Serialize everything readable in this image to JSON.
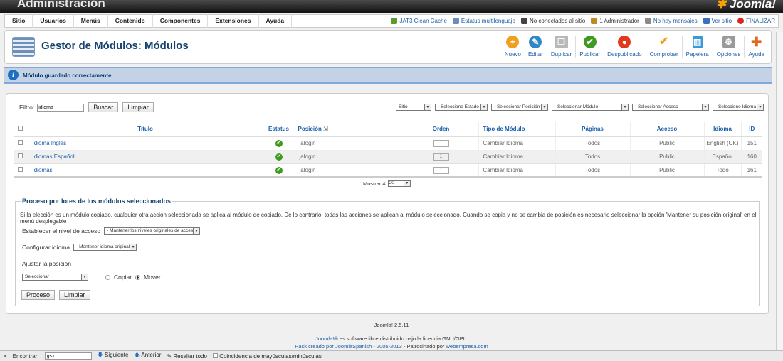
{
  "app": {
    "title": "Administración",
    "logo": "Joomla!"
  },
  "menu": [
    "Sitio",
    "Usuarios",
    "Menús",
    "Contenido",
    "Componentes",
    "Extensiones",
    "Ayuda"
  ],
  "status": {
    "items": [
      {
        "label": "JAT3 Clean Cache",
        "link": true,
        "icon_color": "#5a9b2f"
      },
      {
        "label": "Estatus multilenguaje",
        "link": true,
        "icon_color": "#6a8cc0"
      },
      {
        "label": "No conectados al sitio",
        "link": false,
        "icon_color": "#444444"
      },
      {
        "label": "1 Administrador",
        "link": false,
        "icon_color": "#c08a20"
      },
      {
        "label": "No hay mensajes",
        "link": true,
        "icon_color": "#8a8a8a"
      },
      {
        "label": "Ver sitio",
        "link": true,
        "icon_color": "#3a6ec0"
      }
    ],
    "logout": "FINALIZAR"
  },
  "page": {
    "title": "Gestor de Módulos: Módulos"
  },
  "toolbar": [
    {
      "label": "Nuevo",
      "icon": "plus-icon",
      "color": "#f0a020",
      "glyph": "+"
    },
    {
      "label": "Editar",
      "icon": "pencil-icon",
      "color": "#2e88c8",
      "glyph": "✎"
    },
    {
      "label": "Duplicar",
      "icon": "copy-icon",
      "color": "#b8b8b8",
      "glyph": "❐"
    },
    {
      "label": "Publicar",
      "icon": "check-icon",
      "color": "#3e9a20",
      "glyph": "✔"
    },
    {
      "label": "Despublicado",
      "icon": "unpublish-icon",
      "color": "#e0391c",
      "glyph": "●"
    },
    {
      "label": "Comprobar",
      "icon": "checkin-icon",
      "color": "#f0a020",
      "glyph": "✔"
    },
    {
      "label": "Papelera",
      "icon": "trash-icon",
      "color": "#3a9ad8",
      "glyph": "🗑"
    },
    {
      "label": "Opciones",
      "icon": "options-icon",
      "color": "#9a9a9a",
      "glyph": "⚙"
    },
    {
      "label": "Ayuda",
      "icon": "help-icon",
      "color": "#e26a1c",
      "glyph": "✚"
    }
  ],
  "message": "Módulo guardado correctamente",
  "filter": {
    "label": "Filtro:",
    "value": "idioma",
    "search_btn": "Buscar",
    "clear_btn": "Limpiar"
  },
  "selects": [
    "Sitio",
    "- Seleccione Estado -",
    "- Seleccionar Posición -",
    "- Seleccionar Módulo -",
    "- Seleccionar Acceso -",
    "- Seleccione Idioma -"
  ],
  "table": {
    "headers": [
      "Título",
      "Estatus",
      "Posición",
      "Orden",
      "Tipo de Módulo",
      "Páginas",
      "Acceso",
      "Idioma",
      "ID"
    ],
    "rows": [
      {
        "title": "Idioma Ingles",
        "position": "jalogin",
        "order": "1",
        "type": "Cambiar Idioma",
        "pages": "Todos",
        "access": "Public",
        "language": "English (UK)",
        "id": "151"
      },
      {
        "title": "Idiomas Español",
        "position": "jalogin",
        "order": "1",
        "type": "Cambiar Idioma",
        "pages": "Todos",
        "access": "Public",
        "language": "Español",
        "id": "160"
      },
      {
        "title": "Idiomas",
        "position": "jalogin",
        "order": "1",
        "type": "Cambiar Idioma",
        "pages": "Todos",
        "access": "Public",
        "language": "Todo",
        "id": "161"
      }
    ]
  },
  "pager": {
    "label": "Mostrar #",
    "value": "20"
  },
  "batch": {
    "title": "Proceso por lotes de los módulos seleccionados",
    "description": "Si la elección es un módulo copiado, cualquier otra acción seleccionada se aplica al módulo de copiado. De lo contrario, todas las acciones se aplican al módulo seleccionado. Cuando se copia y no se cambia de posición es necesario seleccionar la opción 'Mantener su posición original' en el menú desplegable",
    "access_label": "Establecer el nivel de acceso",
    "access_value": "- Mantener los niveles originales de acceso -",
    "lang_label": "Configurar idioma",
    "lang_value": "- Mantener idioma original -",
    "pos_label": "Ajustar la posición",
    "pos_value": "Seleccionar",
    "copy": "Copiar",
    "move": "Mover",
    "process_btn": "Proceso",
    "clear_btn": "Limpiar"
  },
  "footer": {
    "version": "Joomla! 2.5.11",
    "joomla_link": "Joomla!®",
    "license": " es software libre distribuido bajo la licencia GNU/GPL.",
    "pack": "Pack creado por JoomlaSpanish - 2005-2013",
    "sponsor": " - Patrocinado por ",
    "sponsor_link": "webempresa.com"
  },
  "findbar": {
    "close": "×",
    "label": "Encontrar:",
    "value": "gsx",
    "next": "Siguiente",
    "prev": "Anterior",
    "highlight": "Resaltar todo",
    "match_case": "Coincidencia de mayúsculas/minúsculas"
  }
}
